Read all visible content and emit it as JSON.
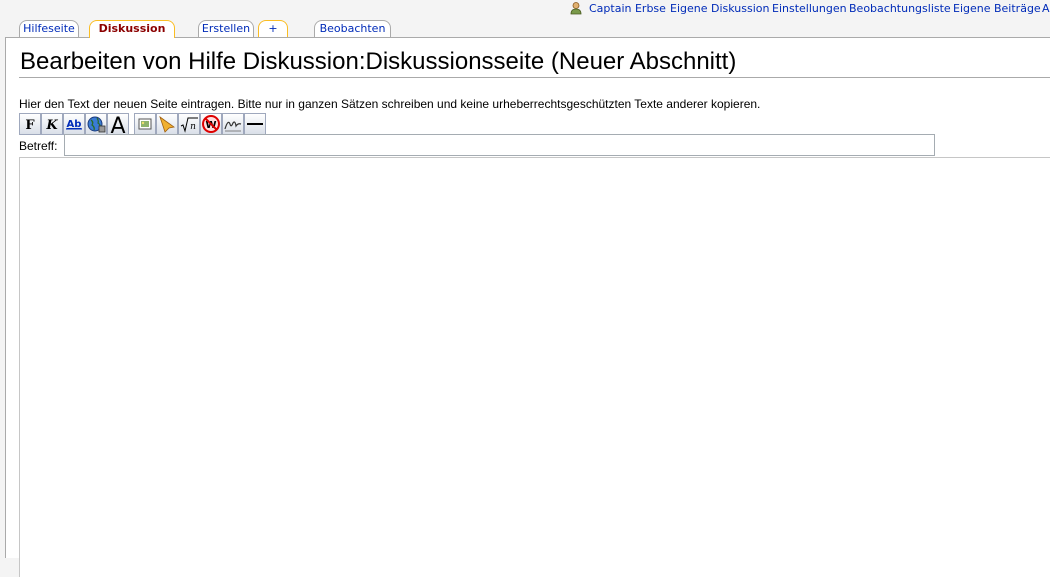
{
  "personal_tools": {
    "username": "Captain Erbse",
    "my_talk": "Eigene Diskussion",
    "preferences": "Einstellungen",
    "watchlist": "Beobachtungsliste",
    "contributions": "Eigene Beiträge",
    "logout_partial": "A"
  },
  "tabs": {
    "help_page": "Hilfeseite",
    "discussion": "Diskussion",
    "create": "Erstellen",
    "new_section": "+",
    "watch": "Beobachten"
  },
  "page": {
    "heading": "Bearbeiten von Hilfe Diskussion:Diskussionsseite (Neuer Abschnitt)",
    "intro": "Hier den Text der neuen Seite eintragen. Bitte nur in ganzen Sätzen schreiben und keine urheberrechtsgeschützten Texte anderer kopieren."
  },
  "toolbar": {
    "buttons": [
      {
        "icon": "bold-icon",
        "glyph": "F"
      },
      {
        "icon": "italic-icon",
        "glyph": "K"
      },
      {
        "icon": "internal-link-icon",
        "glyph": "Ab"
      },
      {
        "icon": "external-link-icon",
        "glyph": ""
      },
      {
        "icon": "headline-icon",
        "glyph": "A"
      },
      {
        "icon": "image-icon",
        "glyph": ""
      },
      {
        "icon": "media-icon",
        "glyph": ""
      },
      {
        "icon": "math-icon",
        "glyph": "√n"
      },
      {
        "icon": "nowiki-icon",
        "glyph": "W"
      },
      {
        "icon": "signature-icon",
        "glyph": ""
      },
      {
        "icon": "horizontal-line-icon",
        "glyph": ""
      }
    ]
  },
  "form": {
    "summary_label": "Betreff:",
    "summary_value": "",
    "text_value": ""
  },
  "colors": {
    "link": "#002bb8",
    "selected_tab_text": "#8b0000",
    "selected_tab_border": "#fabd23"
  }
}
